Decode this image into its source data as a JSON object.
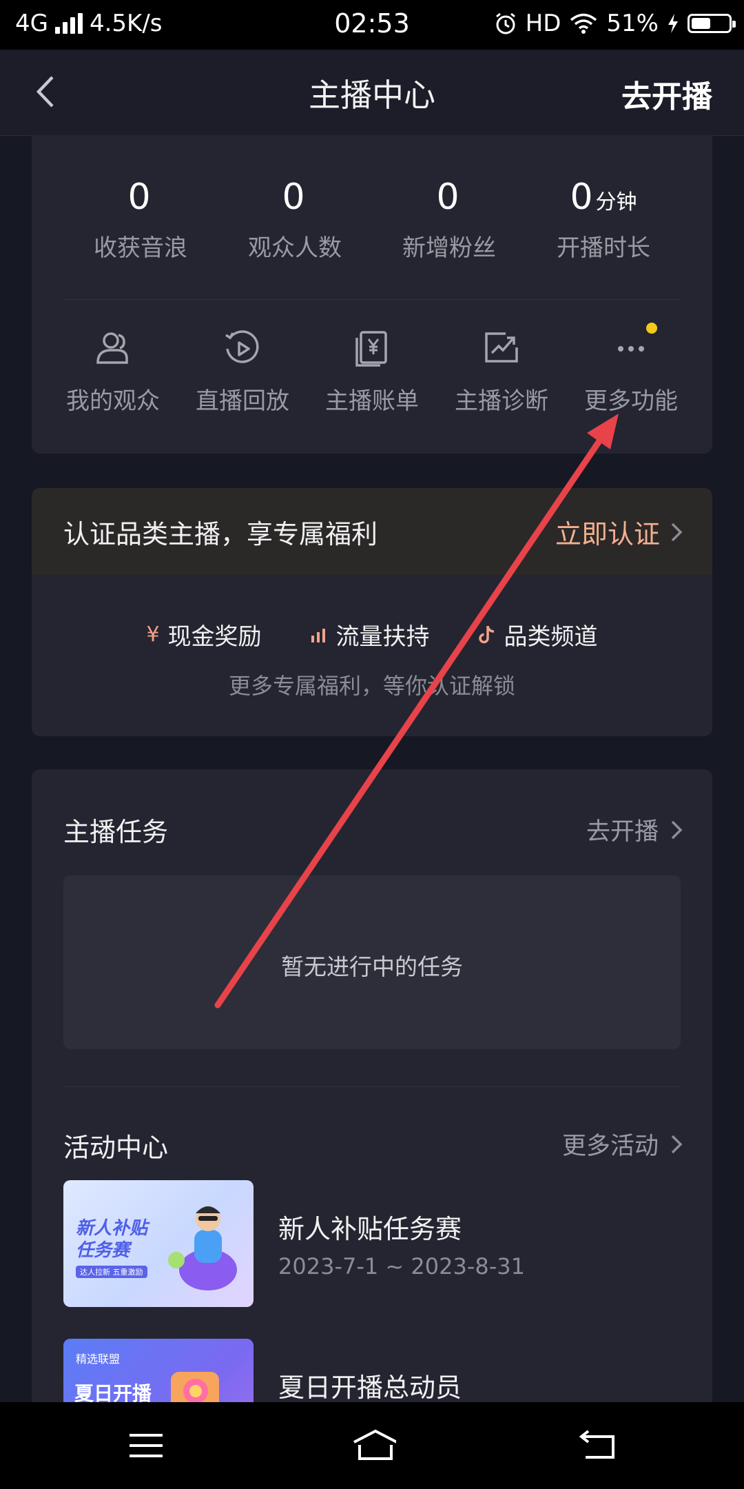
{
  "status_bar": {
    "network": "4G",
    "speed": "4.5K/s",
    "time": "02:53",
    "hd": "HD",
    "battery": "51%",
    "battery_level": 0.51
  },
  "nav": {
    "title": "主播中心",
    "action": "去开播"
  },
  "stats": [
    {
      "value": "0",
      "unit": "",
      "label": "收获音浪"
    },
    {
      "value": "0",
      "unit": "",
      "label": "观众人数"
    },
    {
      "value": "0",
      "unit": "",
      "label": "新增粉丝"
    },
    {
      "value": "0",
      "unit": "分钟",
      "label": "开播时长"
    }
  ],
  "tools": [
    {
      "label": "我的观众",
      "icon": "audience-icon"
    },
    {
      "label": "直播回放",
      "icon": "replay-icon"
    },
    {
      "label": "主播账单",
      "icon": "bill-icon"
    },
    {
      "label": "主播诊断",
      "icon": "diagnosis-icon"
    },
    {
      "label": "更多功能",
      "icon": "more-icon"
    }
  ],
  "certification": {
    "title": "认证品类主播，享专属福利",
    "link": "立即认证",
    "benefits": [
      {
        "label": "现金奖励",
        "icon": "yuan-icon"
      },
      {
        "label": "流量扶持",
        "icon": "signal-bars-icon"
      },
      {
        "label": "品类频道",
        "icon": "tiktok-note-icon"
      }
    ],
    "subtitle": "更多专属福利，等你认证解锁"
  },
  "tasks": {
    "title": "主播任务",
    "link": "去开播",
    "empty": "暂无进行中的任务"
  },
  "activities": {
    "title": "活动中心",
    "link": "更多活动",
    "items": [
      {
        "title": "新人补贴任务赛",
        "date": "2023-7-1 ~ 2023-8-31",
        "thumb_line1": "新人补贴",
        "thumb_line2": "任务赛",
        "thumb_tag": "达人拉新 五重激励"
      },
      {
        "title": "夏日开播总动员",
        "date": "",
        "thumb_line1": "夏日开播",
        "thumb_line2": "",
        "thumb_tag": "精选联盟"
      }
    ]
  },
  "colors": {
    "background": "#161823",
    "card": "#242530",
    "accent_orange": "#f4b08e",
    "badge_yellow": "#f5c91b",
    "annotation_arrow": "#e8434a"
  }
}
